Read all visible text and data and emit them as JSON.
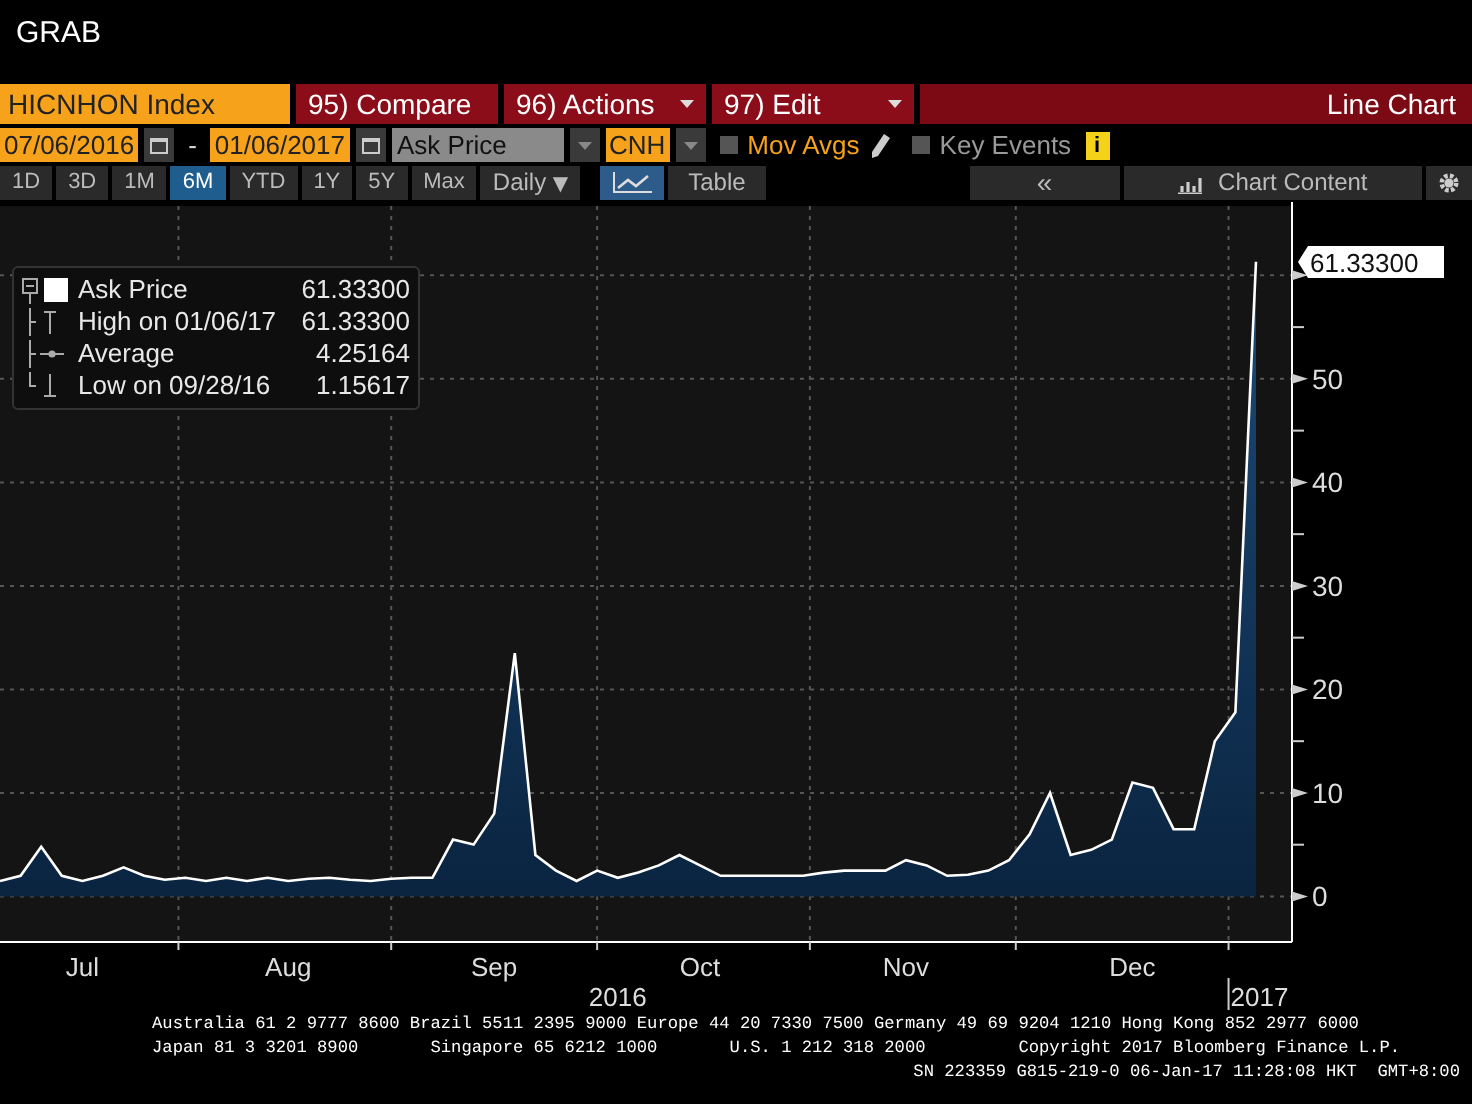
{
  "title": "GRAB",
  "toolbar": {
    "security": "HICNHON Index",
    "buttons": [
      {
        "label": "95) Compare",
        "dropdown": false
      },
      {
        "label": "96) Actions",
        "dropdown": true
      },
      {
        "label": "97) Edit",
        "dropdown": true
      }
    ],
    "chart_type": "Line Chart"
  },
  "range": {
    "start": "07/06/2016",
    "separator": "-",
    "end": "01/06/2017",
    "field": "Ask Price",
    "currency": "CNH",
    "options": [
      {
        "label": "Mov Avgs",
        "checked": false,
        "active": true
      },
      {
        "label": "Key Events",
        "checked": false,
        "active": false
      }
    ],
    "info": "i"
  },
  "periods": [
    {
      "label": "1D",
      "selected": false
    },
    {
      "label": "3D",
      "selected": false
    },
    {
      "label": "1M",
      "selected": false
    },
    {
      "label": "6M",
      "selected": true
    },
    {
      "label": "YTD",
      "selected": false
    },
    {
      "label": "1Y",
      "selected": false
    },
    {
      "label": "5Y",
      "selected": false
    },
    {
      "label": "Max",
      "selected": false
    }
  ],
  "frequency": {
    "label": "Daily",
    "caret": "▼"
  },
  "views": [
    {
      "kind": "chart",
      "selected": true
    },
    {
      "kind": "table",
      "label": "Table",
      "selected": false
    }
  ],
  "collapse": "«",
  "chart_content": "Chart Content",
  "legend": [
    {
      "kind": "series",
      "value": "61.33300"
    },
    {
      "kind": "high",
      "label": "High on 01/06/17",
      "value": "61.33300"
    },
    {
      "kind": "average",
      "label": "Average",
      "value": "4.25164"
    },
    {
      "kind": "low",
      "label": "Low on 09/28/16",
      "value": "1.15617"
    }
  ],
  "last_value": "61.33300",
  "chart_data": {
    "type": "area",
    "categories": [
      null,
      null,
      null,
      null,
      "Jul",
      null,
      null,
      null,
      null,
      null,
      null,
      null,
      null,
      null,
      "Aug",
      null,
      null,
      null,
      null,
      null,
      null,
      null,
      null,
      null,
      "Sep",
      null,
      null,
      null,
      null,
      null,
      null,
      null,
      null,
      null,
      "Oct",
      null,
      null,
      null,
      null,
      null,
      null,
      null,
      null,
      null,
      "Nov",
      null,
      null,
      null,
      null,
      null,
      null,
      null,
      null,
      null,
      null,
      "Dec",
      null,
      null,
      null,
      null,
      null,
      null
    ],
    "series": [
      {
        "name": "Ask Price",
        "color": "#ffffff",
        "values": [
          1.5,
          2,
          4.8,
          2,
          1.5,
          2,
          2.8,
          2,
          1.6,
          1.8,
          1.5,
          1.8,
          1.5,
          1.8,
          1.5,
          1.7,
          1.8,
          1.6,
          1.5,
          1.7,
          1.8,
          1.8,
          5.5,
          5,
          8,
          23.5,
          4,
          2.5,
          1.5,
          2.5,
          1.8,
          2.3,
          3,
          4,
          3,
          2,
          2,
          2,
          2,
          2,
          2.3,
          2.5,
          2.5,
          2.5,
          3.5,
          3,
          2,
          2.1,
          2.5,
          3.5,
          6,
          10,
          4,
          4.5,
          5.5,
          11,
          10.5,
          6.5,
          6.5,
          15,
          17.8,
          61.3
        ]
      }
    ],
    "grid": true,
    "ylim": [
      -4.4,
      66.7
    ],
    "yticks": [
      0,
      10,
      20,
      30,
      40,
      50
    ]
  },
  "years": [
    "2016",
    "2017"
  ],
  "footer": [
    "Australia 61 2 9777 8600 Brazil 5511 2395 9000 Europe 44 20 7330 7500 Germany 49 69 9204 1210 Hong Kong 852 2977 6000",
    "Japan 81 3 3201 8900       Singapore 65 6212 1000       U.S. 1 212 318 2000         Copyright 2017 Bloomberg Finance L.P.",
    "SN 223359 G815-219-0 06-Jan-17 11:28:08 HKT  GMT+8:00"
  ]
}
